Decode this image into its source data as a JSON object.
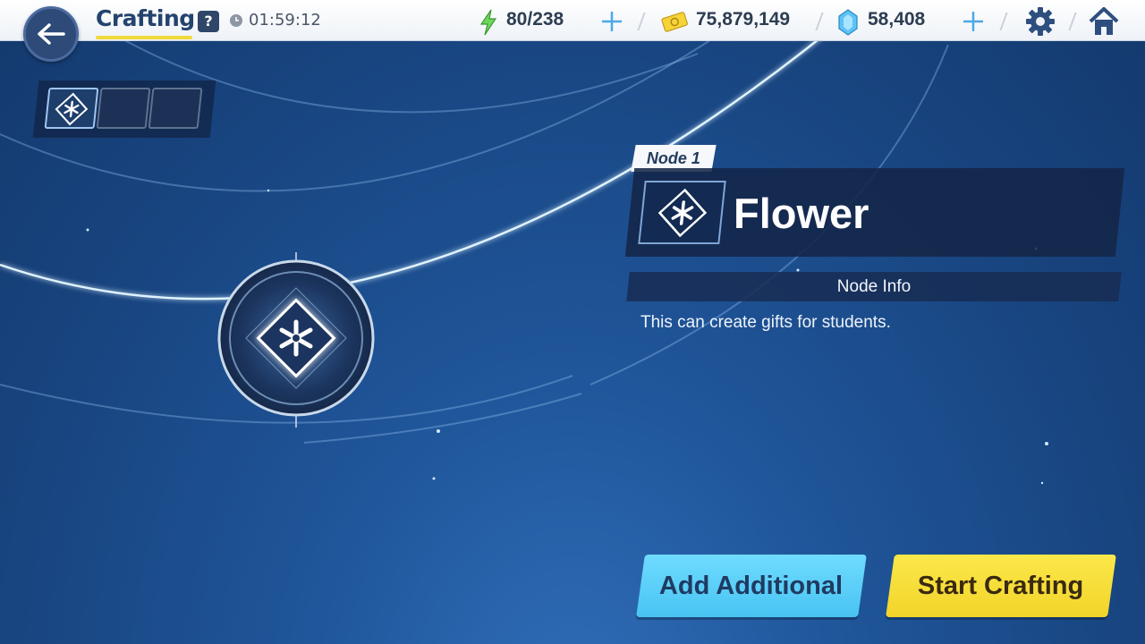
{
  "header": {
    "title": "Crafting",
    "help_label": "?",
    "timer": "01:59:12"
  },
  "resources": {
    "ap": "80/238",
    "credits": "75,879,149",
    "gems": "58,408"
  },
  "node": {
    "tag": "Node 1",
    "name": "Flower",
    "info_label": "Node Info",
    "description": "This can create gifts for students."
  },
  "buttons": {
    "add_additional": "Add Additional",
    "start_crafting": "Start Crafting"
  },
  "icons": {
    "back": "back-arrow-icon",
    "ap": "lightning-icon",
    "credits": "credit-ticket-icon",
    "gems": "pyroxene-gem-icon",
    "settings": "gear-icon",
    "home": "home-icon",
    "node": "flower-star-icon"
  },
  "colors": {
    "accent_yellow": "#f2d42a",
    "accent_cyan": "#48c4f2",
    "title": "#24436e"
  }
}
